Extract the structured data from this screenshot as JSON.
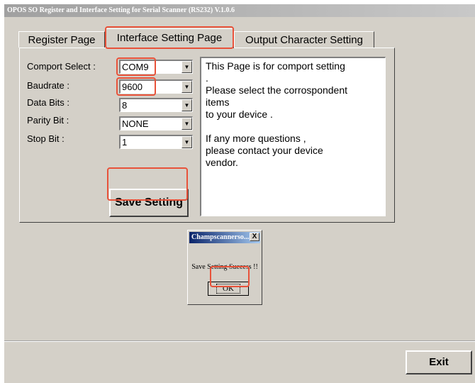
{
  "window": {
    "title": "OPOS SO Register and Interface Setting for Serial Scanner (RS232) V.1.0.6"
  },
  "tabs": [
    {
      "label": "Register Page",
      "active": false
    },
    {
      "label": "Interface Setting Page",
      "active": true
    },
    {
      "label": "Output Character Setting",
      "active": false
    }
  ],
  "settings": {
    "comport": {
      "label": "Comport Select :",
      "value": "COM9"
    },
    "baudrate": {
      "label": "Baudrate :",
      "value": "9600"
    },
    "data_bits": {
      "label": "Data Bits :",
      "value": "8"
    },
    "parity_bit": {
      "label": "Parity Bit :",
      "value": "NONE"
    },
    "stop_bit": {
      "label": "Stop Bit :",
      "value": "1"
    }
  },
  "info_text": [
    "This Page is for comport setting",
    ".",
    "Please select the corrospondent",
    "items",
    "to your device .",
    "",
    "If any more questions ,",
    "please contact your device",
    "vendor."
  ],
  "save_button": {
    "label": "Save Setting"
  },
  "dialog": {
    "title": "Champscannerso...",
    "close_glyph": "X",
    "message": "Save Setting Success !!",
    "ok_label": "OK"
  },
  "exit_button": {
    "label": "Exit"
  },
  "icons": {
    "dropdown_arrow": "▾",
    "close": "×"
  },
  "colors": {
    "window_bg": "#d4d0c8",
    "highlight": "#e8523a",
    "dialog_title": "#0a246a"
  }
}
